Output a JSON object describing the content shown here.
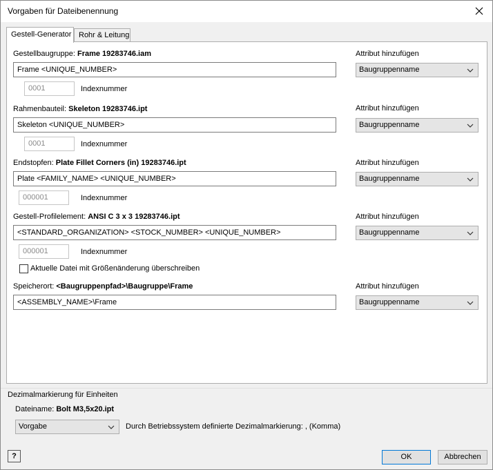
{
  "window": {
    "title": "Vorgaben für Dateibenennung"
  },
  "tabs": [
    {
      "label": "Gestell-Generator"
    },
    {
      "label": "Rohr & Leitung"
    }
  ],
  "attr_label": "Attribut hinzufügen",
  "index_label": "Indexnummer",
  "sections": [
    {
      "prefix": "Gestellbaugruppe:",
      "filename": "Frame 19283746.iam",
      "pattern": "Frame <UNIQUE_NUMBER>",
      "index": "0001",
      "attribute": "Baugruppenname"
    },
    {
      "prefix": "Rahmenbauteil:",
      "filename": "Skeleton 19283746.ipt",
      "pattern": "Skeleton <UNIQUE_NUMBER>",
      "index": "0001",
      "attribute": "Baugruppenname"
    },
    {
      "prefix": "Endstopfen:",
      "filename": "Plate Fillet Corners (in) 19283746.ipt",
      "pattern": "Plate <FAMILY_NAME> <UNIQUE_NUMBER>",
      "index": "000001",
      "attribute": "Baugruppenname"
    },
    {
      "prefix": "Gestell-Profilelement:",
      "filename": "ANSI C 3 x 3 19283746.ipt",
      "pattern": "<STANDARD_ORGANIZATION> <STOCK_NUMBER> <UNIQUE_NUMBER>",
      "index": "000001",
      "attribute": "Baugruppenname"
    }
  ],
  "overwrite_checkbox": {
    "label": "Aktuelle Datei mit Größenänderung überschreiben",
    "checked": false
  },
  "storage": {
    "prefix": "Speicherort:",
    "path": "<Baugruppenpfad>\\Baugruppe\\Frame",
    "pattern": "<ASSEMBLY_NAME>\\Frame",
    "attribute": "Baugruppenname"
  },
  "decimal": {
    "group_label": "Dezimalmarkierung für Einheiten",
    "filename_prefix": "Dateiname:",
    "filename": "Bolt M3,5x20.ipt",
    "mode": "Vorgabe",
    "description": "Durch Betriebssystem definierte Dezimalmarkierung: , (Komma)"
  },
  "buttons": {
    "ok": "OK",
    "cancel": "Abbrechen",
    "help": "?"
  }
}
